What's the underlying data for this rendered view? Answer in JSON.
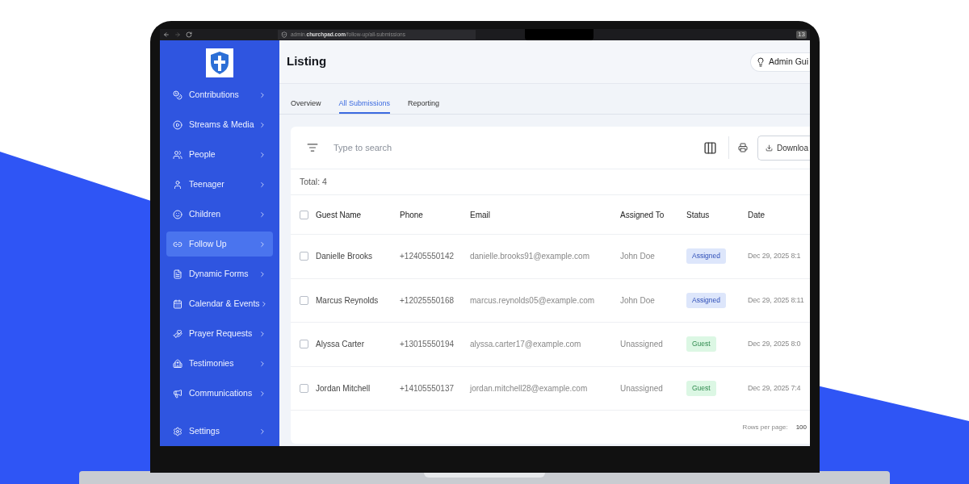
{
  "browser": {
    "url": "admin.**churchpad.com**/follow-up/all-submissions",
    "badge": "13"
  },
  "sidebar": {
    "items": [
      {
        "label": "Contributions",
        "selected": false
      },
      {
        "label": "Streams & Media",
        "selected": false
      },
      {
        "label": "People",
        "selected": false
      },
      {
        "label": "Teenager",
        "selected": false
      },
      {
        "label": "Children",
        "selected": false
      },
      {
        "label": "Follow Up",
        "selected": true
      },
      {
        "label": "Dynamic Forms",
        "selected": false
      },
      {
        "label": "Calendar & Events",
        "selected": false
      },
      {
        "label": "Prayer Requests",
        "selected": false
      },
      {
        "label": "Testimonies",
        "selected": false
      },
      {
        "label": "Communications",
        "selected": false
      }
    ],
    "settings": {
      "label": "Settings",
      "selected": false
    }
  },
  "header": {
    "title": "Listing",
    "guide_button": "Admin Gui"
  },
  "tabs": [
    {
      "label": "Overview",
      "selected": false
    },
    {
      "label": "All Submissions",
      "selected": true
    },
    {
      "label": "Reporting",
      "selected": false
    }
  ],
  "search": {
    "placeholder": "Type to search"
  },
  "download_button": "Downloa",
  "total": "Total: 4",
  "table": {
    "select_all": {
      "checked": false
    },
    "columns": [
      "Guest Name",
      "Phone",
      "Email",
      "Assigned To",
      "Status",
      "Date"
    ],
    "rows": [
      {
        "checked": false,
        "name": "Danielle Brooks",
        "phone": "+12405550142",
        "email": "danielle.brooks91@example.com",
        "assigned_to": "John Doe",
        "status": {
          "label": "Assigned",
          "kind": "assigned"
        },
        "date": "Dec 29, 2025 8:1"
      },
      {
        "checked": false,
        "name": "Marcus Reynolds",
        "phone": "+12025550168",
        "email": "marcus.reynolds05@example.com",
        "assigned_to": "John Doe",
        "status": {
          "label": "Assigned",
          "kind": "assigned"
        },
        "date": "Dec 29, 2025 8:11"
      },
      {
        "checked": false,
        "name": "Alyssa Carter",
        "phone": "+13015550194",
        "email": "alyssa.carter17@example.com",
        "assigned_to": "Unassigned",
        "status": {
          "label": "Guest",
          "kind": "guest"
        },
        "date": "Dec 29, 2025 8:0"
      },
      {
        "checked": false,
        "name": "Jordan Mitchell",
        "phone": "+14105550137",
        "email": "jordan.mitchell28@example.com",
        "assigned_to": "Unassigned",
        "status": {
          "label": "Guest",
          "kind": "guest"
        },
        "date": "Dec 29, 2025 7:4"
      }
    ]
  },
  "footer": {
    "rows_per_page_label": "Rows per page:",
    "rows_per_page": "100"
  }
}
